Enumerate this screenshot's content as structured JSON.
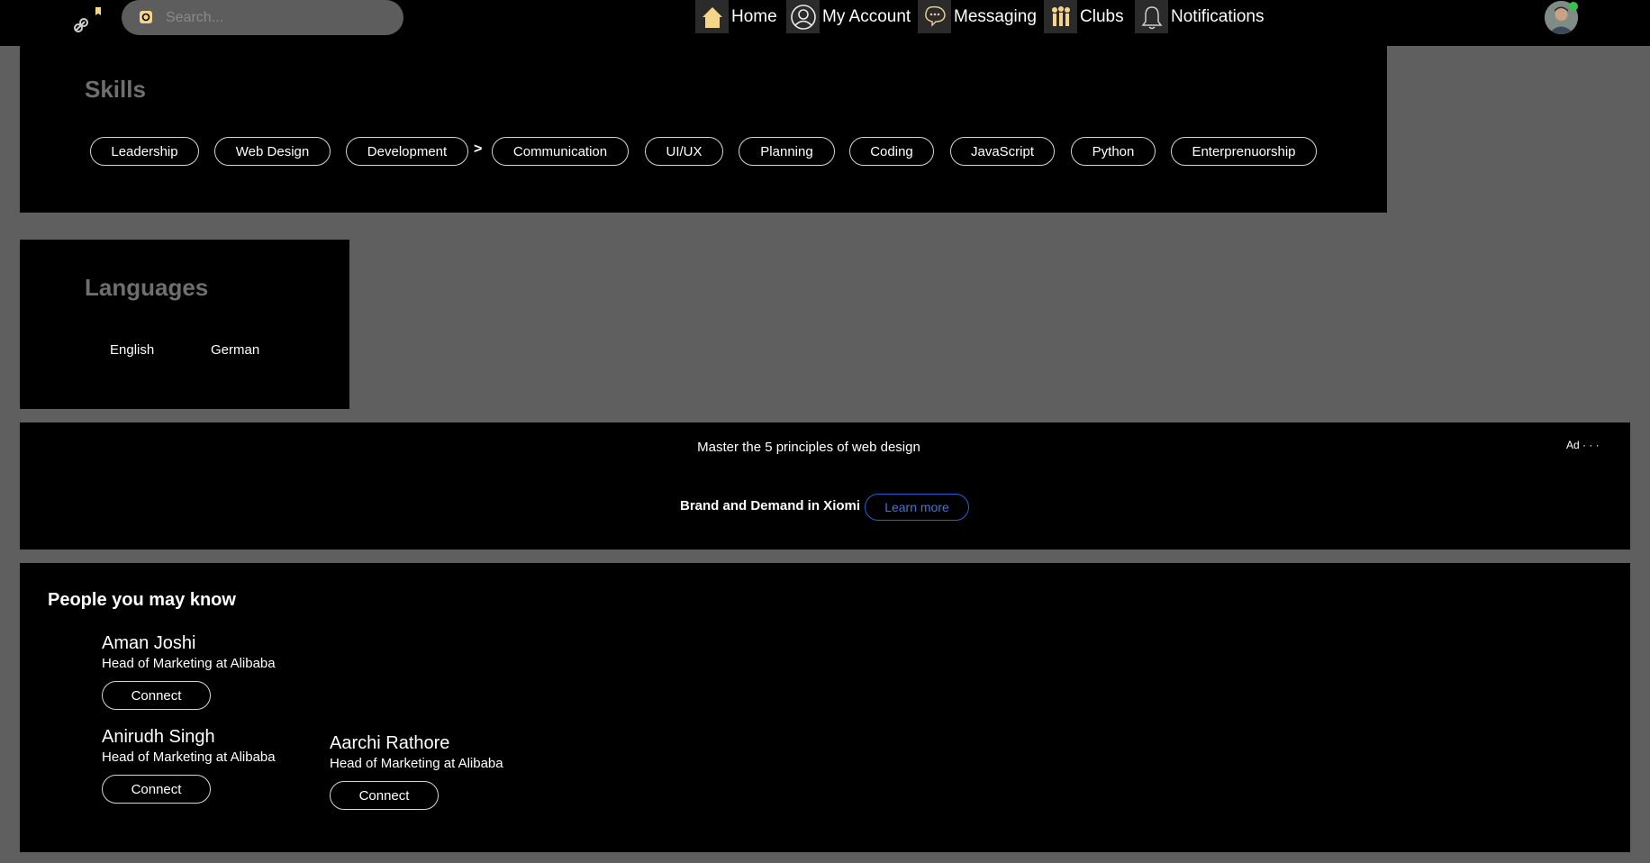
{
  "search": {
    "placeholder": "Search..."
  },
  "nav": {
    "items": [
      {
        "label": "Home",
        "icon": "home-icon"
      },
      {
        "label": "My Account",
        "icon": "user-icon"
      },
      {
        "label": "Messaging",
        "icon": "chat-icon"
      },
      {
        "label": "Clubs",
        "icon": "group-icon"
      },
      {
        "label": "Notifications",
        "icon": "bell-icon"
      }
    ]
  },
  "skills": {
    "title": "Skills",
    "items": [
      "Leadership",
      "Web Design",
      "Development",
      "Communication",
      "UI/UX",
      "Planning",
      "Coding",
      "JavaScript",
      "Python",
      "Enterprenuorship"
    ],
    "separator": ">"
  },
  "languages": {
    "title": "Languages",
    "items": [
      "English",
      "German"
    ]
  },
  "ad": {
    "headline": "Master the 5 principles of web design",
    "label": "Ad · · ·",
    "brand": "Brand and Demand in Xiomi",
    "cta": "Learn more"
  },
  "people": {
    "title": "People you may know",
    "list": [
      {
        "name": "Aman Joshi",
        "role": "Head of Marketing at Alibaba",
        "action": "Connect"
      },
      {
        "name": "Anirudh Singh",
        "role": "Head of Marketing at Alibaba",
        "action": "Connect"
      },
      {
        "name": "Aarchi Rathore",
        "role": "Head of Marketing at Alibaba",
        "action": "Connect"
      }
    ]
  },
  "colors": {
    "accent_icon": "#f5d58a",
    "link": "#3f73e6",
    "online": "#36c24a"
  }
}
